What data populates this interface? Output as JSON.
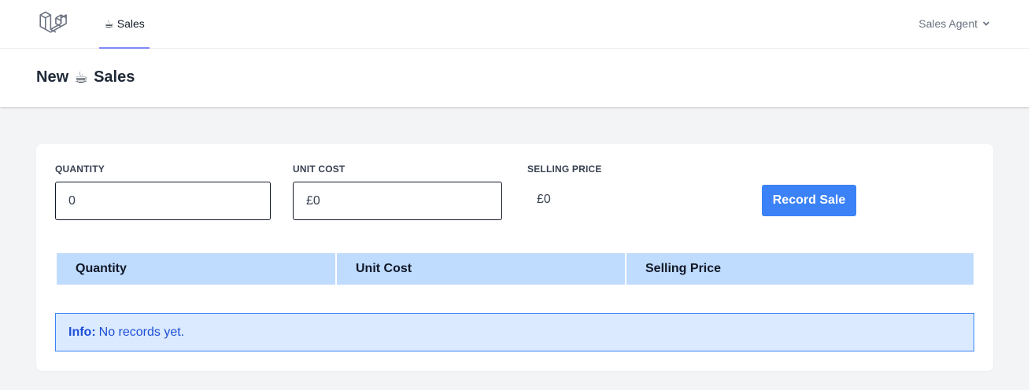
{
  "nav": {
    "sales_emoji": "☕",
    "sales_label": "Sales",
    "user_name": "Sales Agent",
    "logo_icon": "laravel-logo-icon",
    "active_underline_color": "#818cf8"
  },
  "header": {
    "title_prefix": "New",
    "title_emoji": "☕",
    "title_suffix": "Sales"
  },
  "form": {
    "quantity_label": "QUANTITY",
    "quantity_value": "0",
    "unit_cost_label": "UNIT COST",
    "unit_cost_value": "£0",
    "selling_price_label": "SELLING PRICE",
    "selling_price_value": "£0",
    "record_button": "Record Sale",
    "button_color": "#3b82f6"
  },
  "table": {
    "columns": [
      "Quantity",
      "Unit Cost",
      "Selling Price"
    ],
    "header_color": "#bfdbfe"
  },
  "info": {
    "label": "Info:",
    "message": "No records yet."
  }
}
